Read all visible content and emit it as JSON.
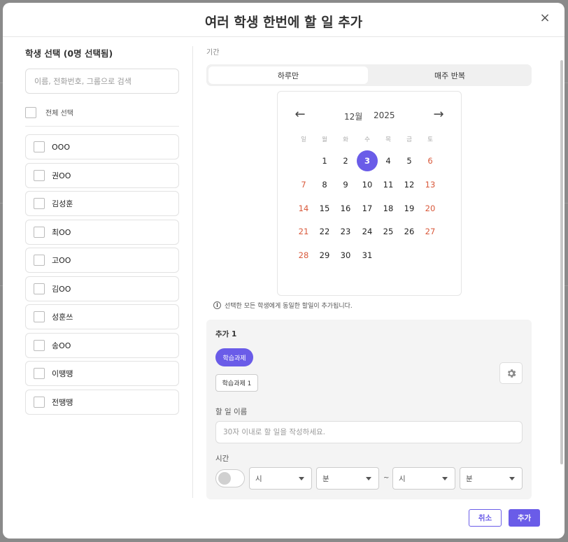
{
  "modal": {
    "title": "여러 학생 한번에 할 일 추가",
    "close_symbol": "×"
  },
  "students_section": {
    "label": "학생 선택 (0명 선택됨)",
    "search_placeholder": "이름, 전화번호, 그룹으로 검색",
    "select_all_label": "전체 선택",
    "students": [
      "OOO",
      "권OO",
      "김성훈",
      "최OO",
      "고OO",
      "김OO",
      "성훈쓰",
      "송OO",
      "이땡땡",
      "전땡땡"
    ]
  },
  "period": {
    "label": "기간",
    "options": [
      "하루만",
      "매주 반복"
    ],
    "selected": "하루만"
  },
  "calendar": {
    "prev_symbol": "←",
    "next_symbol": "→",
    "month_label": "12월",
    "year_label": "2025",
    "weekdays": [
      "일",
      "월",
      "화",
      "수",
      "목",
      "금",
      "토"
    ],
    "days": [
      "1",
      "2",
      "3",
      "4",
      "5",
      "6",
      "7",
      "8",
      "9",
      "10",
      "11",
      "12",
      "13",
      "14",
      "15",
      "16",
      "17",
      "18",
      "19",
      "20",
      "21",
      "22",
      "23",
      "24",
      "25",
      "26",
      "27",
      "28",
      "29",
      "30",
      "31"
    ],
    "first_weekday_index": 1,
    "selected_day": "3",
    "accent_color": "#6a5ce8",
    "weekend_color": "#d9593b"
  },
  "info": {
    "icon": "info-icon",
    "text": "선택한 모든 학생에게 동일한 할일이 추가됩니다."
  },
  "task_panel": {
    "title": "추가 1",
    "category_chip": "학습과제",
    "subcategory_chip": "학습과제 1",
    "settings_icon": "gear-icon",
    "name_label": "할 일 이름",
    "name_placeholder": "30자 이내로 할 일을 작성하세요.",
    "time_label": "시간",
    "time_toggle_on": false,
    "start_hour": "시",
    "start_minute": "분",
    "separator": "~",
    "end_hour": "시",
    "end_minute": "분"
  },
  "footer": {
    "cancel_label": "취소",
    "add_label": "추가"
  }
}
